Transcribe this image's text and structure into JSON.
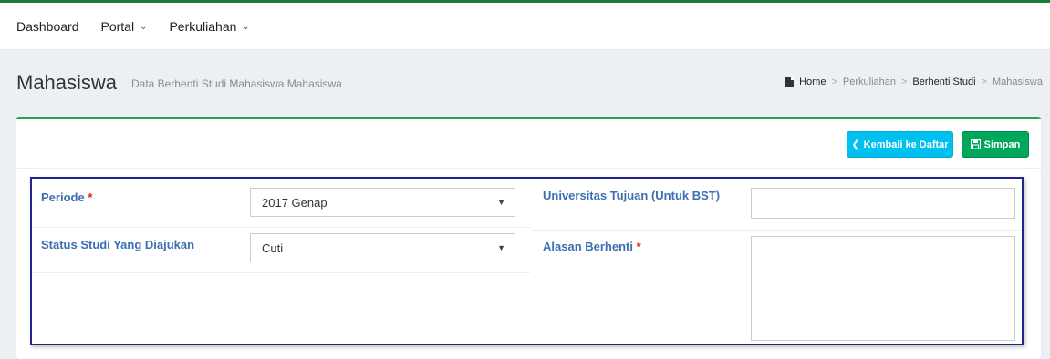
{
  "nav": {
    "dashboard": "Dashboard",
    "portal": "Portal",
    "perkuliahan": "Perkuliahan"
  },
  "header": {
    "title": "Mahasiswa",
    "subtitle": "Data Berhenti Studi Mahasiswa Mahasiswa"
  },
  "breadcrumb": {
    "home": "Home",
    "perkuliahan": "Perkuliahan",
    "berhenti_studi": "Berhenti Studi",
    "mahasiswa": "Mahasiswa",
    "separator": ">"
  },
  "buttons": {
    "back": "Kembali ke Daftar",
    "save": "Simpan"
  },
  "form": {
    "periode_label": "Periode",
    "periode_value": "2017 Genap",
    "status_label": "Status Studi Yang Diajukan",
    "status_value": "Cuti",
    "universitas_label": "Universitas Tujuan (Untuk BST)",
    "universitas_value": "",
    "alasan_label": "Alasan Berhenti",
    "alasan_value": "",
    "required_mark": "*"
  },
  "colors": {
    "topbar_accent": "#1f7a3e",
    "box_accent": "#2e9d54",
    "info_button": "#00c0ef",
    "success_button": "#00a65a",
    "label": "#3c6fb1",
    "required": "#dd1e1e",
    "highlight_frame": "#23238e"
  },
  "icons": {
    "caret": "chevron-down-icon",
    "home": "document-icon",
    "back": "chevron-left-icon",
    "save": "floppy-disk-icon",
    "select_arrow": "triangle-down-icon"
  }
}
